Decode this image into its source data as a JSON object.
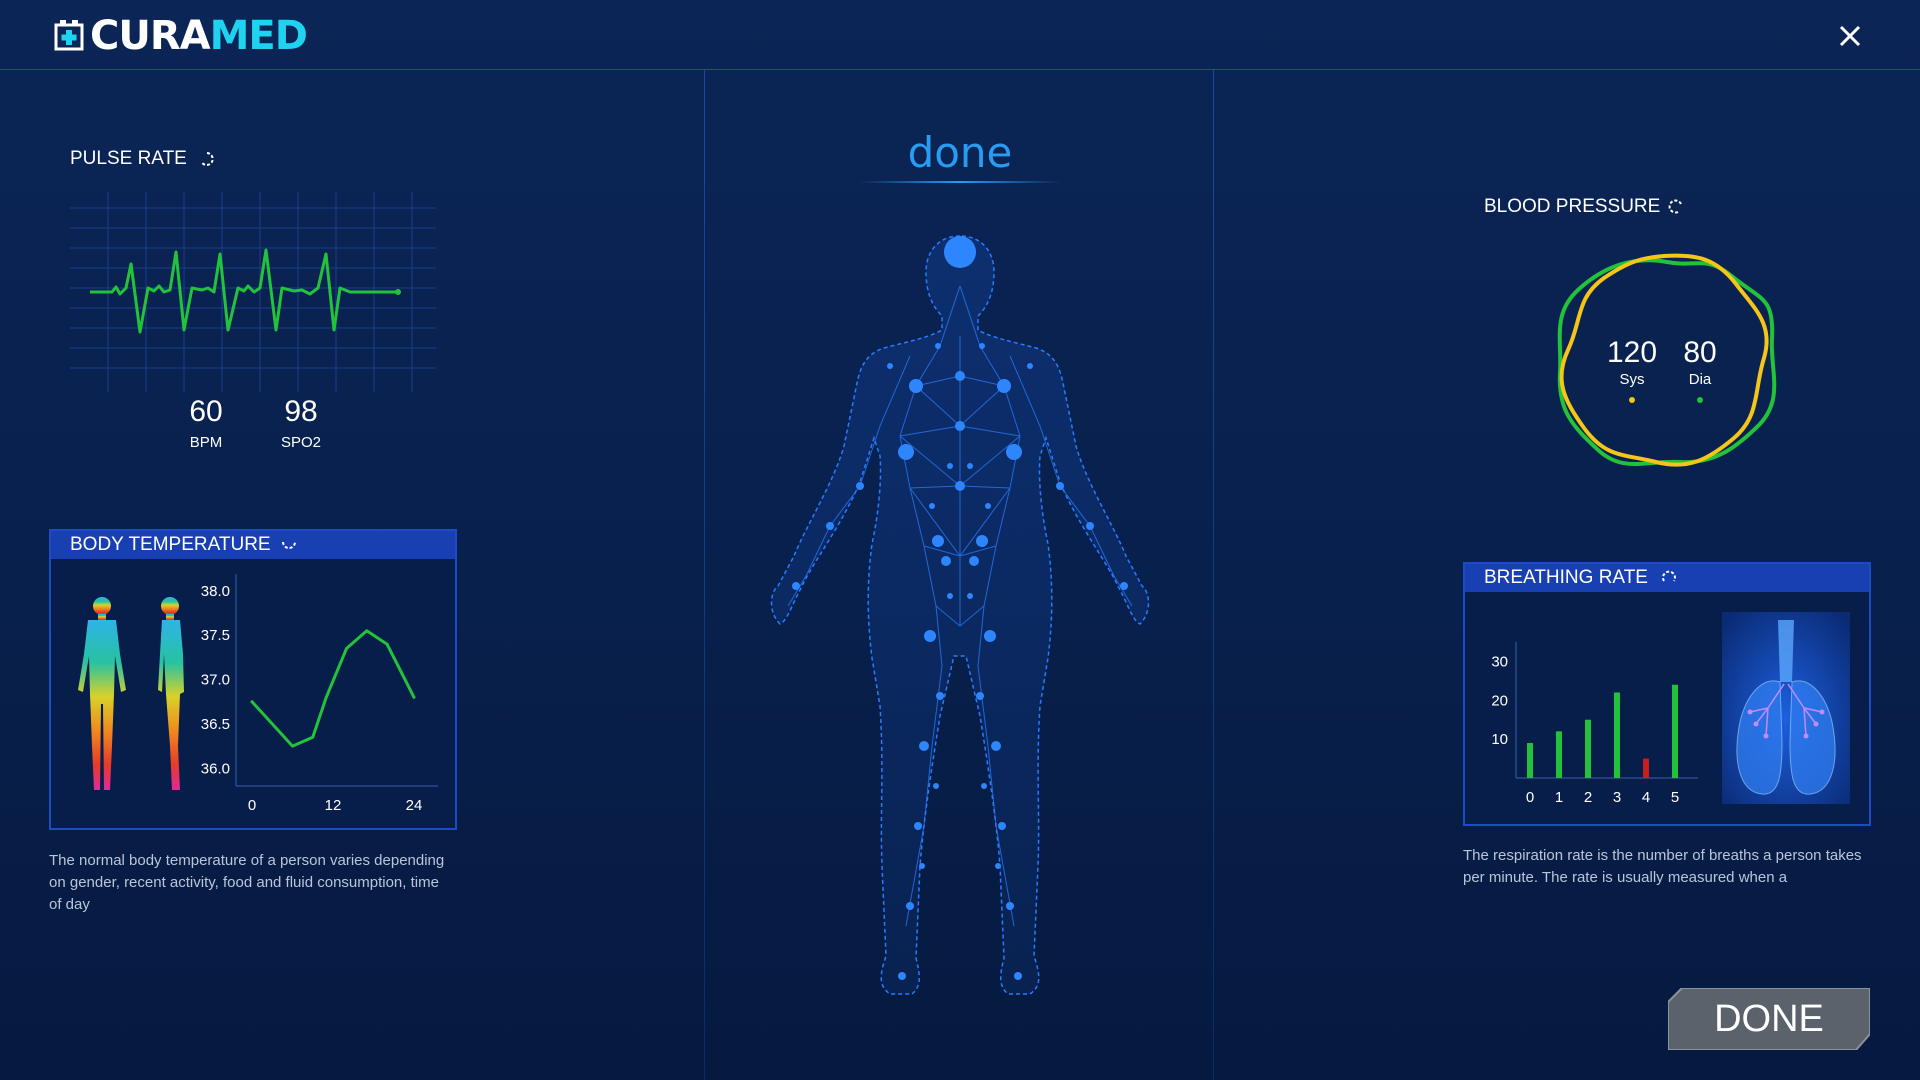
{
  "app": {
    "brand_part1": "CURA",
    "brand_part2": "MED",
    "accent_color": "#1fd2f0"
  },
  "icons": {
    "logo": "medical-cross-icon",
    "close": "close-icon",
    "loading": "loading-spinner-icon"
  },
  "status": {
    "text": "done"
  },
  "pulse": {
    "title": "PULSE RATE",
    "bpm_value": "60",
    "bpm_label": "BPM",
    "spo2_value": "98",
    "spo2_label": "SPO2",
    "waveform_color": "#22c33a"
  },
  "temperature": {
    "title": "BODY TEMPERATURE",
    "description": "The normal body temperature of a person varies depending on gender, recent activity, food and fluid consumption, time of day"
  },
  "blood_pressure": {
    "title": "BLOOD PRESSURE",
    "sys_value": "120",
    "sys_label": "Sys",
    "dia_value": "80",
    "dia_label": "Dia",
    "sys_color": "#f5c518",
    "dia_color": "#22c33a"
  },
  "breathing": {
    "title": "BREATHING RATE",
    "description": "The respiration rate is the number of breaths a person takes per minute. The rate is usually measured when a"
  },
  "done_button": {
    "label": "DONE"
  },
  "chart_data": [
    {
      "type": "line",
      "title": "BODY TEMPERATURE",
      "x_ticks": [
        "0",
        "12",
        "24"
      ],
      "y_ticks": [
        "38.0",
        "37.5",
        "37.0",
        "36.5",
        "36.0"
      ],
      "xlim": [
        0,
        24
      ],
      "ylim": [
        35.8,
        38.1
      ],
      "series": [
        {
          "x": [
            0,
            3,
            6,
            9,
            11,
            14,
            17,
            20,
            22,
            24
          ],
          "y": [
            36.75,
            36.5,
            36.25,
            36.35,
            36.8,
            37.35,
            37.55,
            37.4,
            37.1,
            36.8
          ]
        }
      ],
      "color": "#22c33a"
    },
    {
      "type": "bar",
      "title": "BREATHING RATE",
      "categories": [
        "0",
        "1",
        "2",
        "3",
        "4",
        "5"
      ],
      "values": [
        9,
        12,
        15,
        22,
        5,
        24
      ],
      "y_ticks": [
        "30",
        "20",
        "10"
      ],
      "ylim": [
        0,
        35
      ],
      "colors": [
        "#22c33a",
        "#22c33a",
        "#22c33a",
        "#22c33a",
        "#c81e1e",
        "#22c33a"
      ]
    }
  ]
}
